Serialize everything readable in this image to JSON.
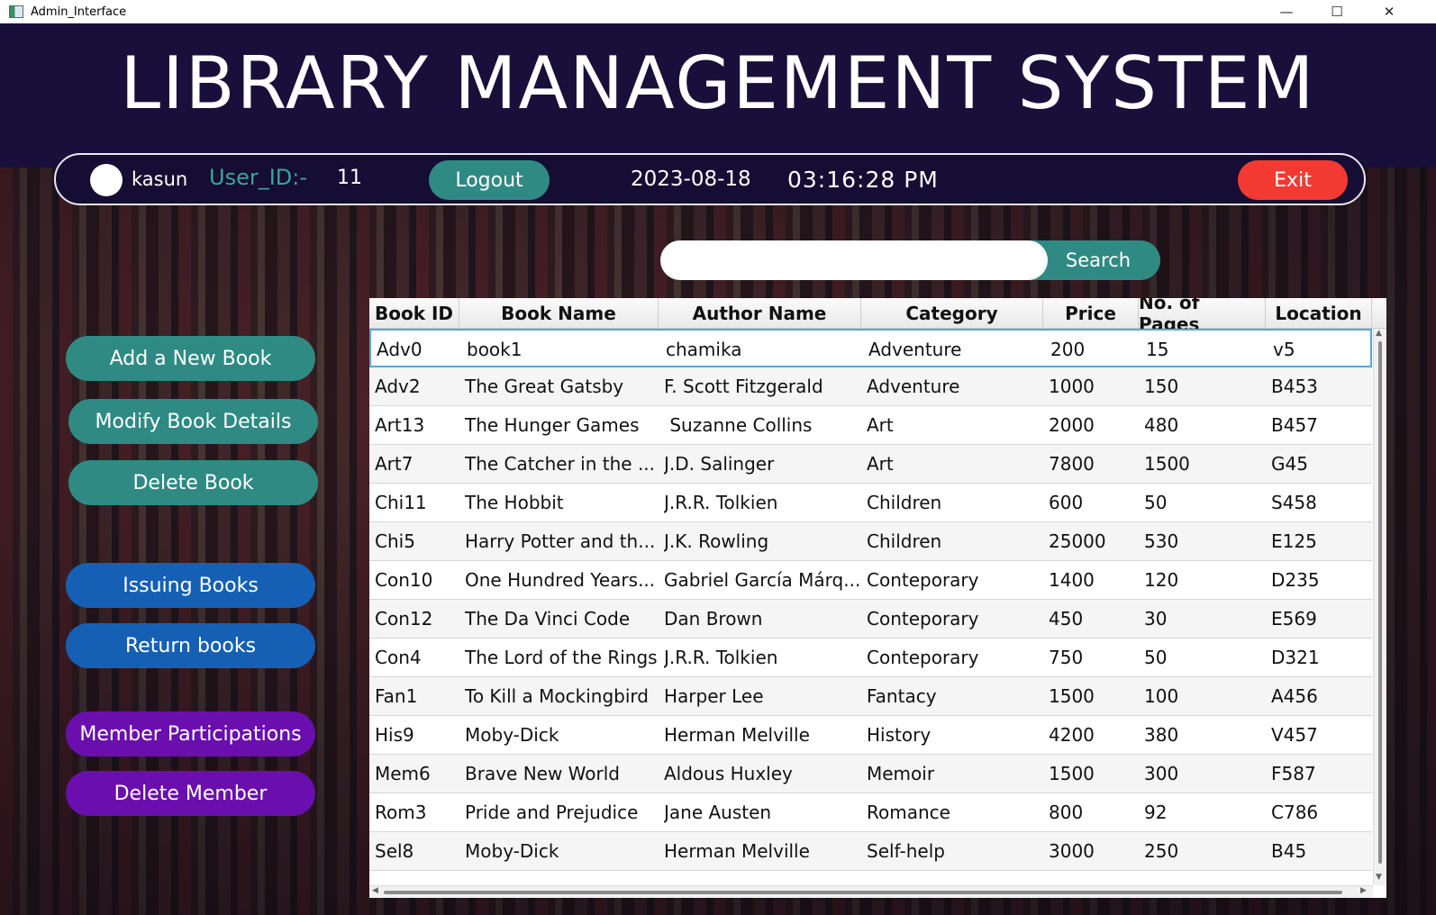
{
  "window": {
    "title": "Admin_Interface"
  },
  "header": {
    "title": "LIBRARY MANAGEMENT SYSTEM"
  },
  "infobar": {
    "username": "kasun",
    "user_id_label": "User_ID:-",
    "user_id": "11",
    "logout_label": "Logout",
    "date": "2023-08-18",
    "time": "03:16:28 PM",
    "exit_label": "Exit"
  },
  "search": {
    "value": "",
    "button_label": "Search"
  },
  "sidebar": {
    "add_book": "Add a New Book",
    "modify_book": "Modify Book Details",
    "delete_book": "Delete Book",
    "issuing_books": "Issuing Books",
    "return_books": "Return books",
    "member_participations": "Member Participations",
    "delete_member": "Delete Member"
  },
  "colors": {
    "header_bg": "#180f3a",
    "teal_button": "#2f8a84",
    "blue_button": "#1560b4",
    "purple_button": "#6a0fae",
    "exit_button": "#f23a32",
    "user_id_label": "#3aa59a"
  },
  "table": {
    "columns": [
      "Book ID",
      "Book Name",
      "Author Name",
      "Category",
      "Price",
      "No. of Pages",
      "Location"
    ],
    "rows": [
      [
        "Adv0",
        "book1",
        "chamika",
        "Adventure",
        "200",
        "15",
        "v5"
      ],
      [
        "Adv2",
        "The Great Gatsby",
        "F. Scott Fitzgerald",
        "Adventure",
        "1000",
        "150",
        "B453"
      ],
      [
        "Art13",
        "The Hunger Games",
        " Suzanne Collins",
        "Art",
        "2000",
        "480",
        "B457"
      ],
      [
        "Art7",
        "The Catcher in the ...",
        "J.D. Salinger",
        "Art",
        "7800",
        "1500",
        "G45"
      ],
      [
        "Chi11",
        "The Hobbit",
        "J.R.R. Tolkien",
        "Children",
        "600",
        "50",
        "S458"
      ],
      [
        "Chi5",
        "Harry Potter and th...",
        "J.K. Rowling",
        "Children",
        "25000",
        "530",
        "E125"
      ],
      [
        "Con10",
        "One Hundred Years...",
        "Gabriel García Márq...",
        "Conteporary",
        "1400",
        "120",
        "D235"
      ],
      [
        "Con12",
        "The Da Vinci Code",
        "Dan Brown",
        "Conteporary",
        "450",
        "30",
        "E569"
      ],
      [
        "Con4",
        "The Lord of the Rings",
        "J.R.R. Tolkien",
        "Conteporary",
        "750",
        "50",
        "D321"
      ],
      [
        "Fan1",
        "To Kill a Mockingbird",
        "Harper Lee",
        "Fantacy",
        "1500",
        "100",
        "A456"
      ],
      [
        "His9",
        "Moby-Dick",
        "Herman Melville",
        "History",
        "4200",
        "380",
        "V457"
      ],
      [
        "Mem6",
        "Brave New World",
        "Aldous Huxley",
        "Memoir",
        "1500",
        "300",
        "F587"
      ],
      [
        "Rom3",
        "Pride and Prejudice",
        "Jane Austen",
        "Romance",
        "800",
        "92",
        "C786"
      ],
      [
        "Sel8",
        "Moby-Dick",
        "Herman Melville",
        "Self-help",
        "3000",
        "250",
        "B45"
      ]
    ],
    "selected_row": 0
  }
}
